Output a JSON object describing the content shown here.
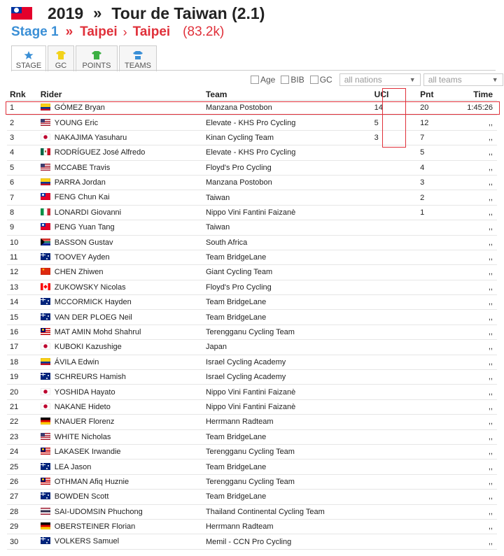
{
  "header": {
    "year": "2019",
    "sep": "»",
    "race": "Tour de Taiwan (2.1)"
  },
  "subheader": {
    "stage": "Stage 1",
    "sep1": "»",
    "from": "Taipei",
    "sep2": "›",
    "to": "Taipei",
    "distance": "(83.2k)"
  },
  "tabs": [
    {
      "label": "STAGE",
      "icon": "star-icon"
    },
    {
      "label": "GC",
      "icon": "yellow-jersey-icon"
    },
    {
      "label": "POINTS",
      "icon": "green-jersey-icon"
    },
    {
      "label": "TEAMS",
      "icon": "team-jersey-icon"
    }
  ],
  "filters": {
    "age": "Age",
    "bib": "BIB",
    "gc": "GC",
    "nations_placeholder": "all nations",
    "teams_placeholder": "all teams"
  },
  "columns": {
    "rnk": "Rnk",
    "rider": "Rider",
    "team": "Team",
    "uci": "UCI",
    "pnt": "Pnt",
    "time": "Time"
  },
  "colors": {
    "accent_blue": "#3a8fd6",
    "accent_red": "#e0303a"
  },
  "rows": [
    {
      "rnk": "1",
      "flag": "co",
      "rider": "GÓMEZ Bryan",
      "team": "Manzana Postobon",
      "uci": "14",
      "pnt": "20",
      "time": "1:45:26"
    },
    {
      "rnk": "2",
      "flag": "us",
      "rider": "YOUNG Eric",
      "team": "Elevate - KHS Pro Cycling",
      "uci": "5",
      "pnt": "12",
      "time": ",,"
    },
    {
      "rnk": "3",
      "flag": "jp",
      "rider": "NAKAJIMA Yasuharu",
      "team": "Kinan Cycling Team",
      "uci": "3",
      "pnt": "7",
      "time": ",,"
    },
    {
      "rnk": "4",
      "flag": "mx",
      "rider": "RODRÍGUEZ José Alfredo",
      "team": "Elevate - KHS Pro Cycling",
      "uci": "",
      "pnt": "5",
      "time": ",,"
    },
    {
      "rnk": "5",
      "flag": "us",
      "rider": "MCCABE Travis",
      "team": "Floyd's Pro Cycling",
      "uci": "",
      "pnt": "4",
      "time": ",,"
    },
    {
      "rnk": "6",
      "flag": "co",
      "rider": "PARRA Jordan",
      "team": "Manzana Postobon",
      "uci": "",
      "pnt": "3",
      "time": ",,"
    },
    {
      "rnk": "7",
      "flag": "tw",
      "rider": "FENG Chun Kai",
      "team": "Taiwan",
      "uci": "",
      "pnt": "2",
      "time": ",,"
    },
    {
      "rnk": "8",
      "flag": "it",
      "rider": "LONARDI Giovanni",
      "team": "Nippo Vini Fantini Faizanè",
      "uci": "",
      "pnt": "1",
      "time": ",,"
    },
    {
      "rnk": "9",
      "flag": "tw",
      "rider": "PENG Yuan Tang",
      "team": "Taiwan",
      "uci": "",
      "pnt": "",
      "time": ",,"
    },
    {
      "rnk": "10",
      "flag": "za",
      "rider": "BASSON Gustav",
      "team": "South Africa",
      "uci": "",
      "pnt": "",
      "time": ",,"
    },
    {
      "rnk": "11",
      "flag": "au",
      "rider": "TOOVEY Ayden",
      "team": "Team BridgeLane",
      "uci": "",
      "pnt": "",
      "time": ",,"
    },
    {
      "rnk": "12",
      "flag": "cn",
      "rider": "CHEN Zhiwen",
      "team": "Giant Cycling Team",
      "uci": "",
      "pnt": "",
      "time": ",,"
    },
    {
      "rnk": "13",
      "flag": "ca",
      "rider": "ZUKOWSKY Nicolas",
      "team": "Floyd's Pro Cycling",
      "uci": "",
      "pnt": "",
      "time": ",,"
    },
    {
      "rnk": "14",
      "flag": "au",
      "rider": "MCCORMICK Hayden",
      "team": "Team BridgeLane",
      "uci": "",
      "pnt": "",
      "time": ",,"
    },
    {
      "rnk": "15",
      "flag": "au",
      "rider": "VAN DER PLOEG Neil",
      "team": "Team BridgeLane",
      "uci": "",
      "pnt": "",
      "time": ",,"
    },
    {
      "rnk": "16",
      "flag": "my",
      "rider": "MAT AMIN Mohd Shahrul",
      "team": "Terengganu Cycling Team",
      "uci": "",
      "pnt": "",
      "time": ",,"
    },
    {
      "rnk": "17",
      "flag": "jp",
      "rider": "KUBOKI Kazushige",
      "team": "Japan",
      "uci": "",
      "pnt": "",
      "time": ",,"
    },
    {
      "rnk": "18",
      "flag": "co",
      "rider": "ÁVILA Edwin",
      "team": "Israel Cycling Academy",
      "uci": "",
      "pnt": "",
      "time": ",,"
    },
    {
      "rnk": "19",
      "flag": "au",
      "rider": "SCHREURS Hamish",
      "team": "Israel Cycling Academy",
      "uci": "",
      "pnt": "",
      "time": ",,"
    },
    {
      "rnk": "20",
      "flag": "jp",
      "rider": "YOSHIDA Hayato",
      "team": "Nippo Vini Fantini Faizanè",
      "uci": "",
      "pnt": "",
      "time": ",,"
    },
    {
      "rnk": "21",
      "flag": "jp",
      "rider": "NAKANE Hideto",
      "team": "Nippo Vini Fantini Faizanè",
      "uci": "",
      "pnt": "",
      "time": ",,"
    },
    {
      "rnk": "22",
      "flag": "de",
      "rider": "KNAUER Florenz",
      "team": "Herrmann Radteam",
      "uci": "",
      "pnt": "",
      "time": ",,"
    },
    {
      "rnk": "23",
      "flag": "us",
      "rider": "WHITE Nicholas",
      "team": "Team BridgeLane",
      "uci": "",
      "pnt": "",
      "time": ",,"
    },
    {
      "rnk": "24",
      "flag": "my",
      "rider": "LAKASEK Irwandie",
      "team": "Terengganu Cycling Team",
      "uci": "",
      "pnt": "",
      "time": ",,"
    },
    {
      "rnk": "25",
      "flag": "au",
      "rider": "LEA Jason",
      "team": "Team BridgeLane",
      "uci": "",
      "pnt": "",
      "time": ",,"
    },
    {
      "rnk": "26",
      "flag": "my",
      "rider": "OTHMAN Afiq Huznie",
      "team": "Terengganu Cycling Team",
      "uci": "",
      "pnt": "",
      "time": ",,"
    },
    {
      "rnk": "27",
      "flag": "au",
      "rider": "BOWDEN Scott",
      "team": "Team BridgeLane",
      "uci": "",
      "pnt": "",
      "time": ",,"
    },
    {
      "rnk": "28",
      "flag": "th",
      "rider": "SAI-UDOMSIN Phuchong",
      "team": "Thailand Continental Cycling Team",
      "uci": "",
      "pnt": "",
      "time": ",,"
    },
    {
      "rnk": "29",
      "flag": "de",
      "rider": "OBERSTEINER Florian",
      "team": "Herrmann Radteam",
      "uci": "",
      "pnt": "",
      "time": ",,"
    },
    {
      "rnk": "30",
      "flag": "au",
      "rider": "VOLKERS Samuel",
      "team": "Memil - CCN Pro Cycling",
      "uci": "",
      "pnt": "",
      "time": ",,"
    }
  ]
}
